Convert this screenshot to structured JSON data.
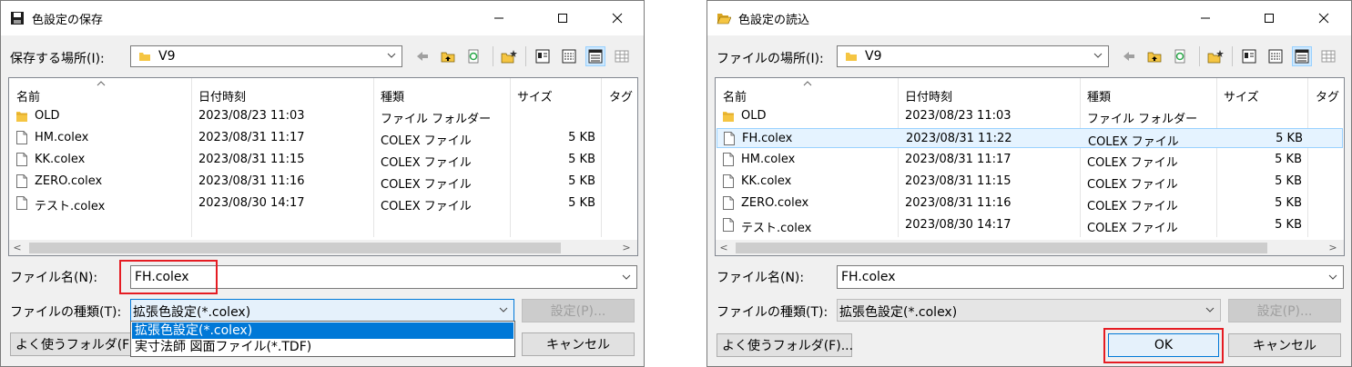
{
  "save_dialog": {
    "title": "色設定の保存",
    "location_label": "保存する場所(I):",
    "location_value": "V9",
    "columns": [
      "名前",
      "日付時刻",
      "種類",
      "サイズ",
      "タグ"
    ],
    "files": [
      {
        "name": "OLD",
        "date": "2023/08/23 11:03",
        "type": "ファイル フォルダー",
        "size": "",
        "icon": "folder-icon"
      },
      {
        "name": "HM.colex",
        "date": "2023/08/31 11:17",
        "type": "COLEX ファイル",
        "size": "5 KB",
        "icon": "file-icon"
      },
      {
        "name": "KK.colex",
        "date": "2023/08/31 11:15",
        "type": "COLEX ファイル",
        "size": "5 KB",
        "icon": "file-icon"
      },
      {
        "name": "ZERO.colex",
        "date": "2023/08/31 11:16",
        "type": "COLEX ファイル",
        "size": "5 KB",
        "icon": "file-icon"
      },
      {
        "name": "テスト.colex",
        "date": "2023/08/30 14:17",
        "type": "COLEX ファイル",
        "size": "5 KB",
        "icon": "file-icon"
      }
    ],
    "filename_label": "ファイル名(N):",
    "filename_value": "FH.colex",
    "filetype_label": "ファイルの種類(T):",
    "filetype_value": "拡張色設定(*.colex)",
    "filetype_options": [
      "拡張色設定(*.colex)",
      "実寸法師 図面ファイル(*.TDF)"
    ],
    "settings_button": "設定(P)...",
    "favorites_button": "よく使うフォルダ(F)...",
    "cancel_button": "キャンセル"
  },
  "open_dialog": {
    "title": "色設定の読込",
    "location_label": "ファイルの場所(I):",
    "location_value": "V9",
    "columns": [
      "名前",
      "日付時刻",
      "種類",
      "サイズ",
      "タグ"
    ],
    "files": [
      {
        "name": "OLD",
        "date": "2023/08/23 11:03",
        "type": "ファイル フォルダー",
        "size": "",
        "icon": "folder-icon",
        "selected": false
      },
      {
        "name": "FH.colex",
        "date": "2023/08/31 11:22",
        "type": "COLEX ファイル",
        "size": "5 KB",
        "icon": "file-icon",
        "selected": true
      },
      {
        "name": "HM.colex",
        "date": "2023/08/31 11:17",
        "type": "COLEX ファイル",
        "size": "5 KB",
        "icon": "file-icon",
        "selected": false
      },
      {
        "name": "KK.colex",
        "date": "2023/08/31 11:15",
        "type": "COLEX ファイル",
        "size": "5 KB",
        "icon": "file-icon",
        "selected": false
      },
      {
        "name": "ZERO.colex",
        "date": "2023/08/31 11:16",
        "type": "COLEX ファイル",
        "size": "5 KB",
        "icon": "file-icon",
        "selected": false
      },
      {
        "name": "テスト.colex",
        "date": "2023/08/30 14:17",
        "type": "COLEX ファイル",
        "size": "5 KB",
        "icon": "file-icon",
        "selected": false
      }
    ],
    "filename_label": "ファイル名(N):",
    "filename_value": "FH.colex",
    "filetype_label": "ファイルの種類(T):",
    "filetype_value": "拡張色設定(*.colex)",
    "settings_button": "設定(P)...",
    "favorites_button": "よく使うフォルダ(F)...",
    "ok_button": "OK",
    "cancel_button": "キャンセル"
  },
  "colors": {
    "highlight_red": "#e51c23",
    "selection_blue": "#0078d7",
    "row_selected": "#e5f3ff"
  }
}
